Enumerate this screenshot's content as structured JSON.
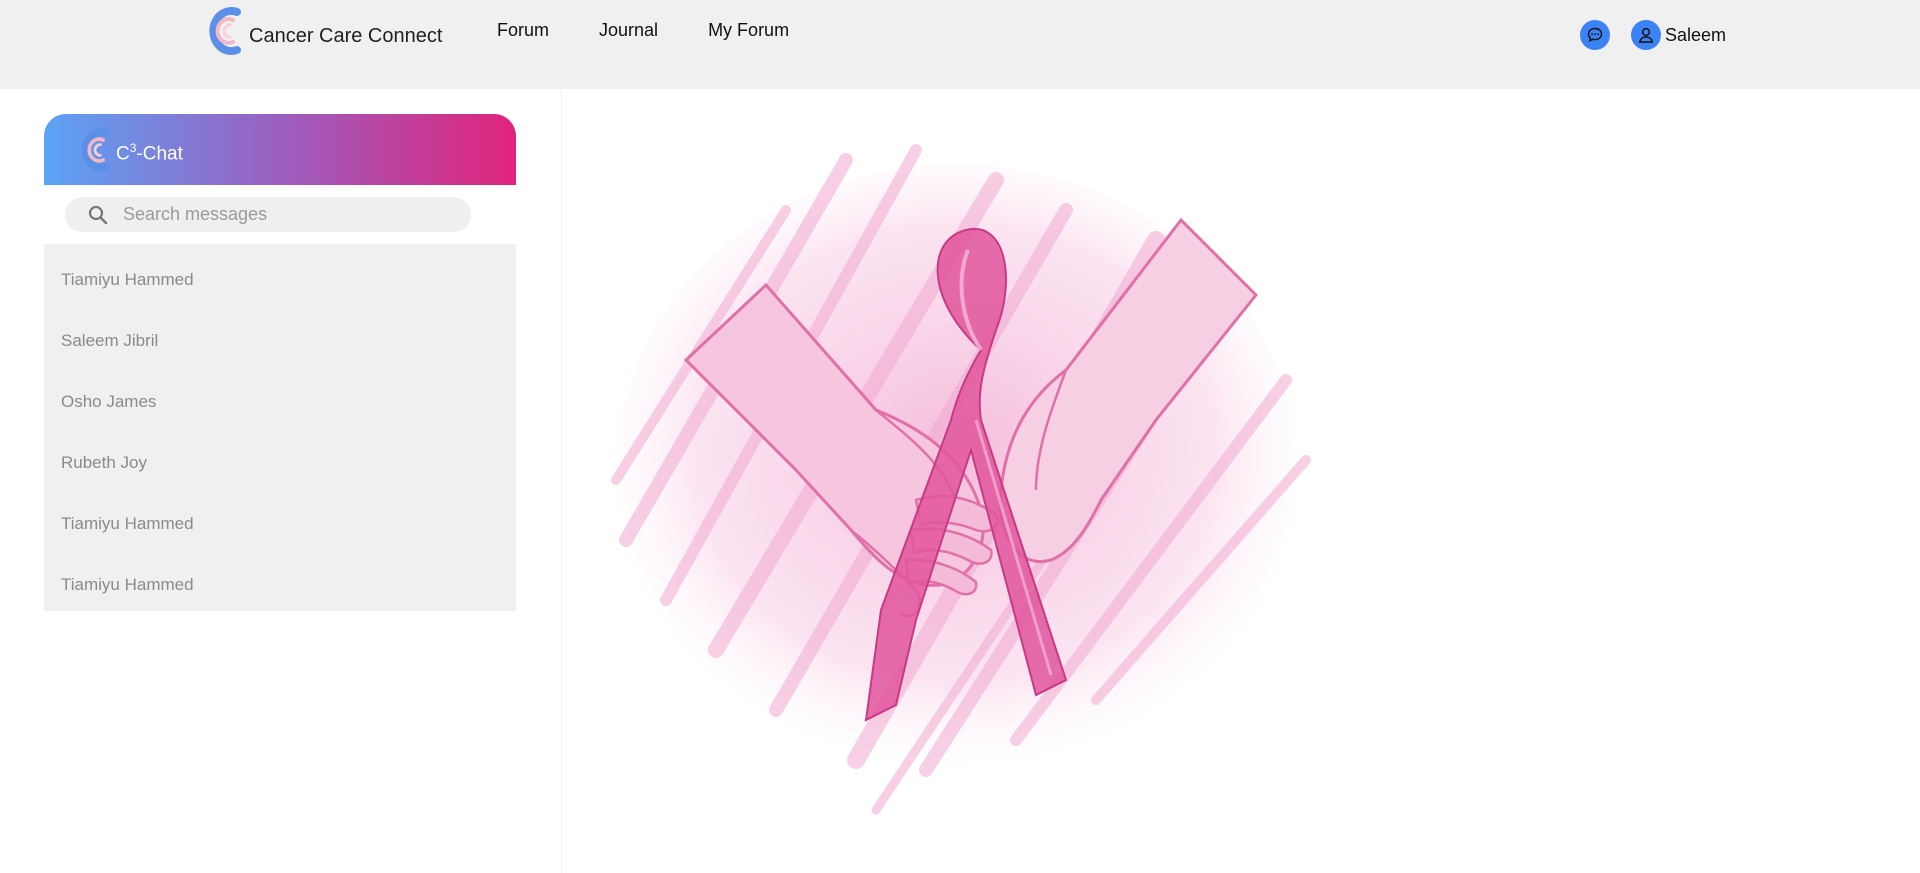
{
  "header": {
    "brand_name": "Cancer Care Connect",
    "nav": [
      {
        "label": "Forum"
      },
      {
        "label": "Journal"
      },
      {
        "label": "My Forum"
      }
    ],
    "user_name": "Saleem",
    "chat_icon": "chat-bubble-icon",
    "user_icon": "user-icon"
  },
  "chat": {
    "title": "C",
    "title_sup": "3",
    "title_suffix": "-Chat",
    "search_placeholder": "Search messages",
    "contacts": [
      {
        "name": "Tiamiyu Hammed"
      },
      {
        "name": "Saleem Jibril"
      },
      {
        "name": "Osho James"
      },
      {
        "name": "Rubeth Joy"
      },
      {
        "name": "Tiamiyu Hammed"
      },
      {
        "name": "Tiamiyu Hammed"
      }
    ]
  },
  "colors": {
    "accent_blue": "#3b82f6",
    "gradient_start": "#5ba4f5",
    "gradient_end": "#e0247a",
    "ribbon_pink": "#e0509a"
  }
}
